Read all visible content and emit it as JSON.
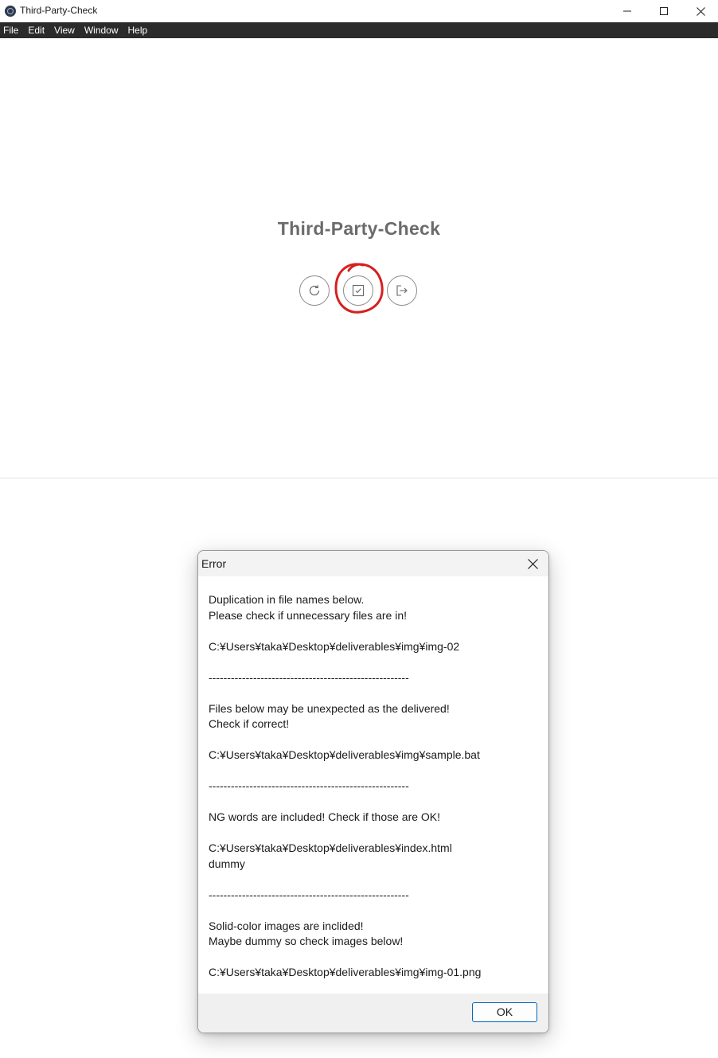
{
  "window": {
    "title": "Third-Party-Check",
    "icon": "app-icon",
    "controls": [
      "minimize-icon",
      "maximize-icon",
      "close-icon"
    ]
  },
  "menubar": {
    "items": [
      {
        "label": "File"
      },
      {
        "label": "Edit"
      },
      {
        "label": "View"
      },
      {
        "label": "Window"
      },
      {
        "label": "Help"
      }
    ]
  },
  "main": {
    "heading": "Third-Party-Check",
    "buttons": [
      {
        "icon": "reload-icon"
      },
      {
        "icon": "check-icon",
        "highlighted": true,
        "highlight_color": "#d62020"
      },
      {
        "icon": "exit-icon"
      }
    ]
  },
  "dialog": {
    "title": "Error",
    "lines": [
      "Duplication in file names below.",
      "Please check if unnecessary files are in!",
      "",
      "C:¥Users¥taka¥Desktop¥deliverables¥img¥img-02",
      "",
      "------------------------------------------------------",
      "",
      "Files below may be unexpected as the delivered!",
      "Check if correct!",
      "",
      "C:¥Users¥taka¥Desktop¥deliverables¥img¥sample.bat",
      "",
      "------------------------------------------------------",
      "",
      "NG words are included! Check if those are OK!",
      "",
      "C:¥Users¥taka¥Desktop¥deliverables¥index.html",
      "dummy",
      "",
      "------------------------------------------------------",
      "",
      "Solid-color images are inclided!",
      "Maybe dummy so check images below!",
      "",
      "C:¥Users¥taka¥Desktop¥deliverables¥img¥img-01.png"
    ],
    "ok_label": "OK",
    "accent_color": "#0067c0"
  }
}
